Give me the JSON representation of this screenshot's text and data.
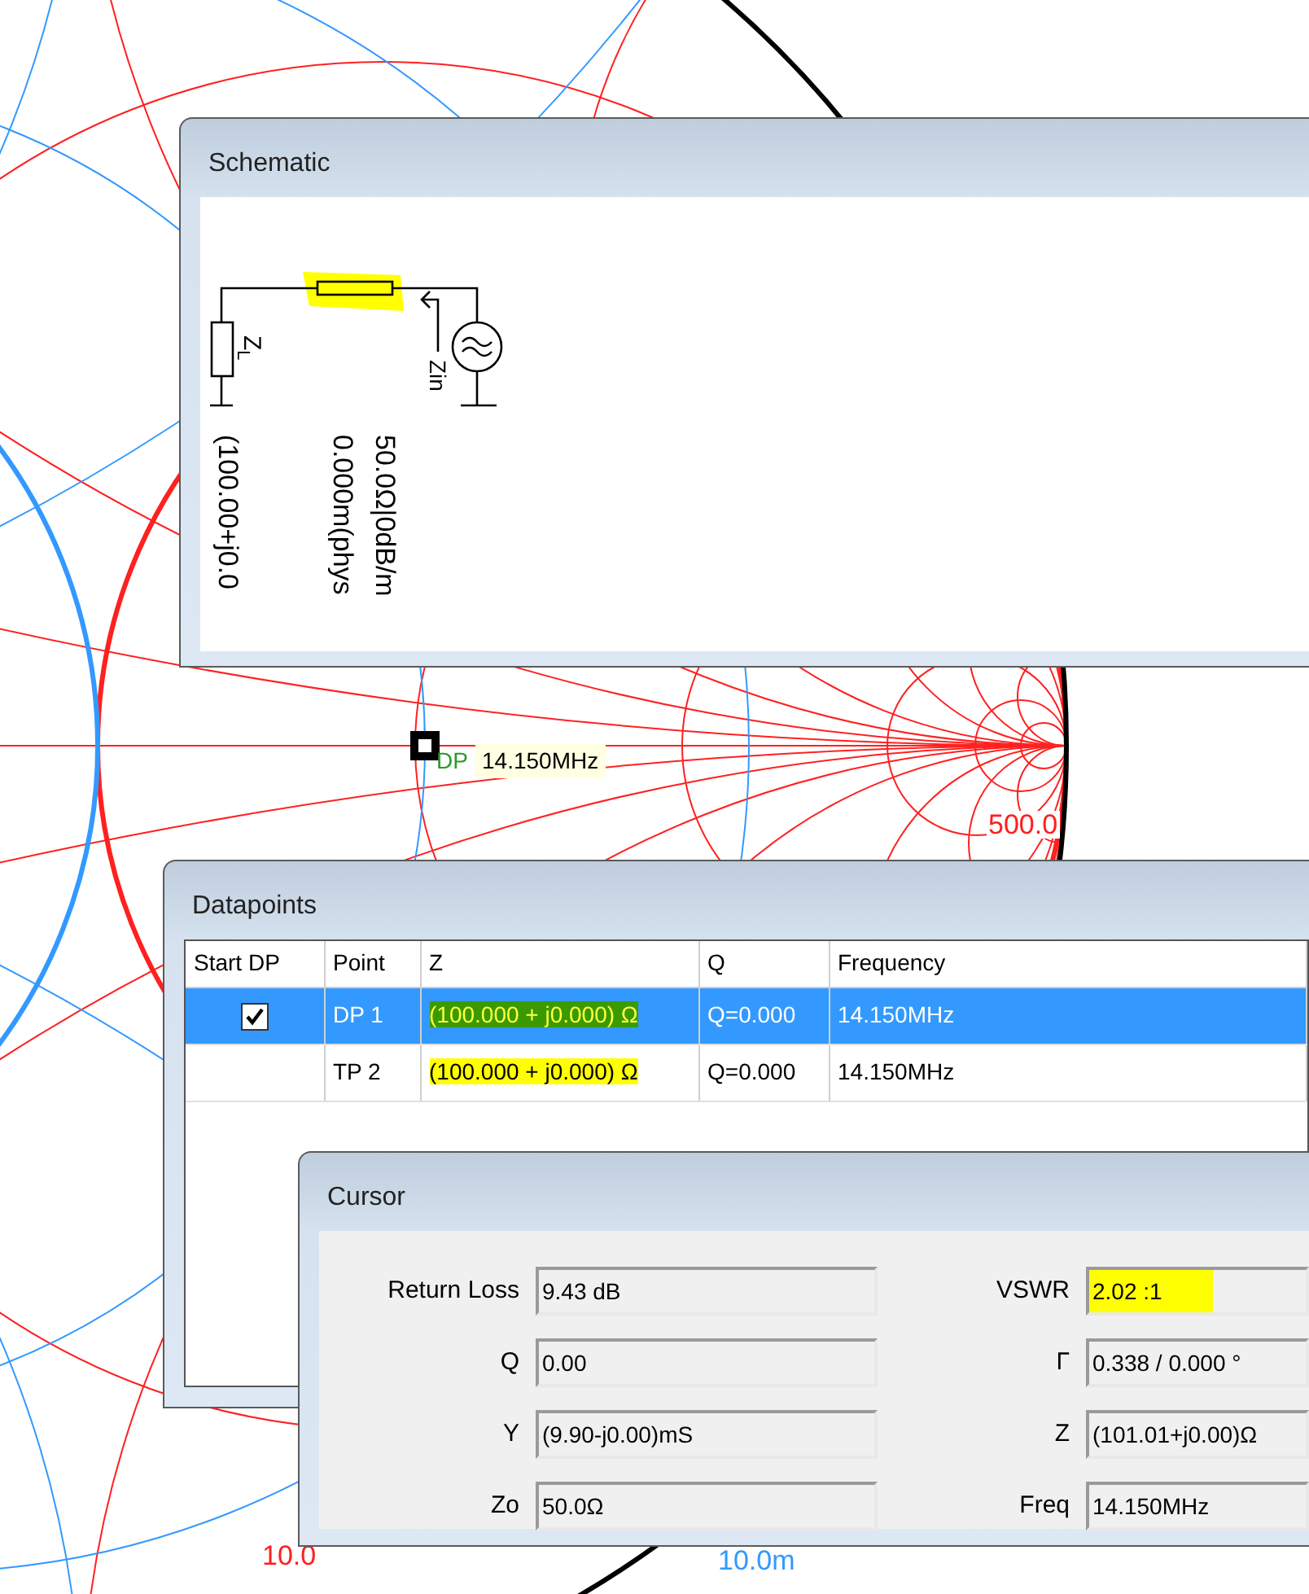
{
  "chart": {
    "labels": [
      {
        "text": "500.0",
        "color": "#ff2020"
      },
      {
        "text": "10.0",
        "color": "#ff2020"
      },
      {
        "text": "10.0m",
        "color": "#3399ff"
      }
    ],
    "marker": {
      "tags": [
        "DP"
      ],
      "frequency": "14.150MHz"
    }
  },
  "schematic": {
    "title": "Schematic",
    "load_label": "Z$_{L}$",
    "input_label": "Zin",
    "line_highlighted": true,
    "annotations": [
      "(100.00+j0.0",
      "0.000m(phys",
      "50.0Ω|0dB/m"
    ]
  },
  "datapoints": {
    "title": "Datapoints",
    "columns": [
      "Start DP",
      "Point",
      "Z",
      "Q",
      "Frequency"
    ],
    "rows": [
      {
        "selected": true,
        "start": true,
        "point": "DP 1",
        "z": "(100.000 + j0.000) Ω",
        "z_highlighted": true,
        "q": "Q=0.000",
        "frequency": "14.150MHz"
      },
      {
        "selected": false,
        "start": false,
        "point": "TP 2",
        "z": "(100.000 + j0.000) Ω",
        "z_highlighted": true,
        "q": "Q=0.000",
        "frequency": "14.150MHz"
      }
    ]
  },
  "cursor": {
    "title": "Cursor",
    "fields": [
      {
        "label": "Return Loss",
        "value": "9.43 dB",
        "highlighted": false
      },
      {
        "label": "VSWR",
        "value": "2.02 :1",
        "highlighted": true
      },
      {
        "label": "Q",
        "value": "0.00",
        "highlighted": false
      },
      {
        "label": "Γ",
        "value": "0.338 / 0.000 °",
        "highlighted": false
      },
      {
        "label": "Y",
        "value": "(9.90-j0.00)mS",
        "highlighted": false
      },
      {
        "label": "Z",
        "value": "(101.01+j0.00)Ω",
        "highlighted": false
      },
      {
        "label": "Zo",
        "value": "50.0Ω",
        "highlighted": false
      },
      {
        "label": "Freq",
        "value": "14.150MHz",
        "highlighted": false
      }
    ]
  }
}
